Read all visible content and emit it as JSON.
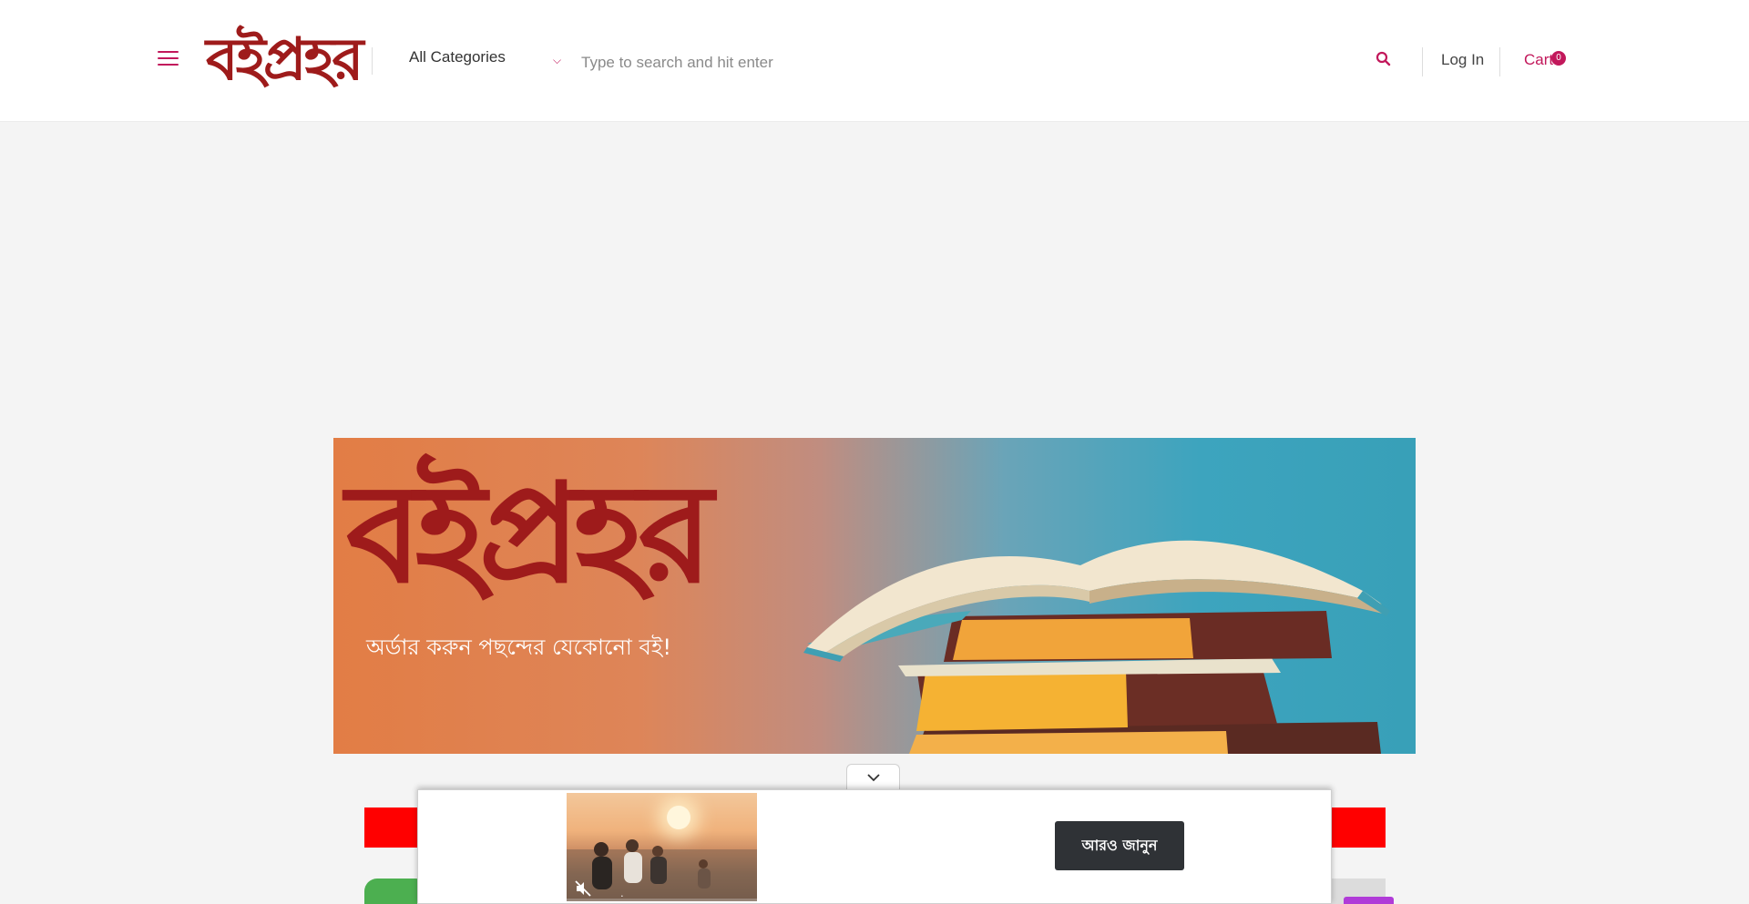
{
  "header": {
    "logo_text": "বইপ্রহর",
    "category_select": "All Categories",
    "search_placeholder": "Type to search and hit enter",
    "login_label": "Log In",
    "cart_label": "Cart",
    "cart_count": "0"
  },
  "banner": {
    "logo_text": "বইপ্রহর",
    "tagline": "অর্ডার করুন পছন্দের যেকোনো বই!"
  },
  "ad": {
    "cta_label": "আরও জানুন",
    "video_caption": "•"
  },
  "icons": {
    "menu": "hamburger-menu-icon",
    "dropdown": "chevron-down-icon",
    "search": "search-icon",
    "collapse": "chevron-down-icon",
    "mute": "speaker-muted-icon"
  },
  "colors": {
    "accent": "#c2185b",
    "brand": "#9e1b1b",
    "banner_red_strip": "#ff0000",
    "cta_background": "#2f3236"
  }
}
